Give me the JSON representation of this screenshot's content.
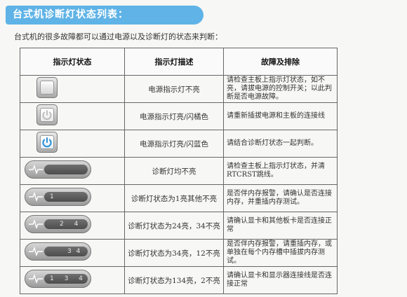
{
  "title": "台式机诊断灯状态列表：",
  "intro": "台式机的很多故障都可以通过电源以及诊断灯的状态来判断：",
  "table": {
    "headers": [
      "指示灯状态",
      "指示灯描述",
      "故障及排除"
    ],
    "rows": [
      {
        "indicator": "power-off",
        "desc": "电源指示灯不亮",
        "fix": "请检查主板上指示灯状态，如不亮，请拔电源的控制开关；以此判断是否电源故障。"
      },
      {
        "indicator": "power-orange",
        "desc": "电源指示灯亮/闪橘色",
        "fix": "请重新插拔电源和主板的连接线"
      },
      {
        "indicator": "power-blue",
        "desc": "电源指示灯亮/闪蓝色",
        "fix": "请结合诊断灯状态一起判断。"
      },
      {
        "indicator": "diag",
        "lights": "",
        "desc": "诊断灯均不亮",
        "fix": "请检查主板上指示灯状态，并清RTCRST跳线。"
      },
      {
        "indicator": "diag",
        "lights": "1",
        "desc": "诊断灯状态为1亮其他不亮",
        "fix": "是否伴内存报警，请确认是否连接内存，并重插内存测试。"
      },
      {
        "indicator": "diag",
        "lights": "2 4",
        "desc": "诊断灯状态为24亮，34不亮",
        "fix": "请确认显卡和其他板卡是否连接正常"
      },
      {
        "indicator": "diag",
        "lights": "3 4",
        "desc": "诊断灯状态为34亮，12不亮",
        "fix": "是否伴内存报警，请重插内存，或单独在每个内存槽中插拔内存测试。"
      },
      {
        "indicator": "diag",
        "lights": "1 3 4",
        "desc": "诊断灯状态为134亮，2不亮",
        "fix": "请确认显卡和显示器连接线是否连接正常"
      }
    ]
  },
  "colors": {
    "title_bg": "#5fb3e6",
    "power_blue": "#2a8fd6",
    "power_orange": "#e08a2a",
    "diag_pill": "#5a5a5a"
  }
}
